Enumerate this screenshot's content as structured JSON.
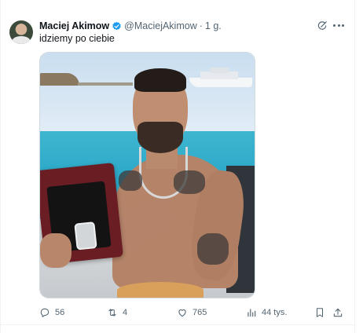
{
  "tweet": {
    "author_name": "Maciej Akimow",
    "handle": "@MaciejAkimow",
    "separator": "·",
    "time": "1 g.",
    "text": "idziemy po ciebie"
  },
  "icons": {
    "verified": "verified-badge-icon",
    "grok": "grok-icon",
    "more": "more-icon",
    "reply": "reply-icon",
    "retweet": "retweet-icon",
    "like": "like-icon",
    "views": "views-icon",
    "bookmark": "bookmark-icon",
    "share": "share-icon"
  },
  "metrics": {
    "replies": "56",
    "retweets": "4",
    "likes": "765",
    "views": "44 tys."
  },
  "colors": {
    "verified_blue": "#1d9bf0",
    "secondary_text": "#536471",
    "primary_text": "#0f1419"
  }
}
